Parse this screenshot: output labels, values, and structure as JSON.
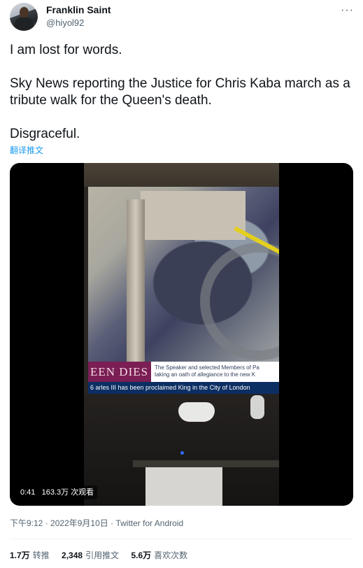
{
  "author": {
    "name": "Franklin Saint",
    "handle": "@hiyol92"
  },
  "more_icon": "more-dots-icon",
  "tweet": {
    "paragraphs": [
      "I am lost for words.",
      "Sky News reporting the Justice for Chris Kaba march as a tribute walk for the Queen's death.",
      "Disgraceful."
    ],
    "translate_label": "翻译推文"
  },
  "video": {
    "banner_headline": "EEN DIES",
    "banner_text_line1": "The Speaker and selected Members of Pa",
    "banner_text_line2": "taking an oath of allegiance to the new K",
    "ticker_text": "6  arles III has been proclaimed King in the City of London",
    "duration": "0:41",
    "views": "163.3万 次观看"
  },
  "meta": {
    "time": "下午9:12",
    "date": "2022年9月10日",
    "source": "Twitter for Android"
  },
  "stats": {
    "retweets_count": "1.7万",
    "retweets_label": "转推",
    "quotes_count": "2,348",
    "quotes_label": "引用推文",
    "likes_count": "5.6万",
    "likes_label": "喜欢次数"
  },
  "colors": {
    "accent": "#1d9bf0",
    "secondary_text": "#536471",
    "primary_text": "#0f1419"
  }
}
